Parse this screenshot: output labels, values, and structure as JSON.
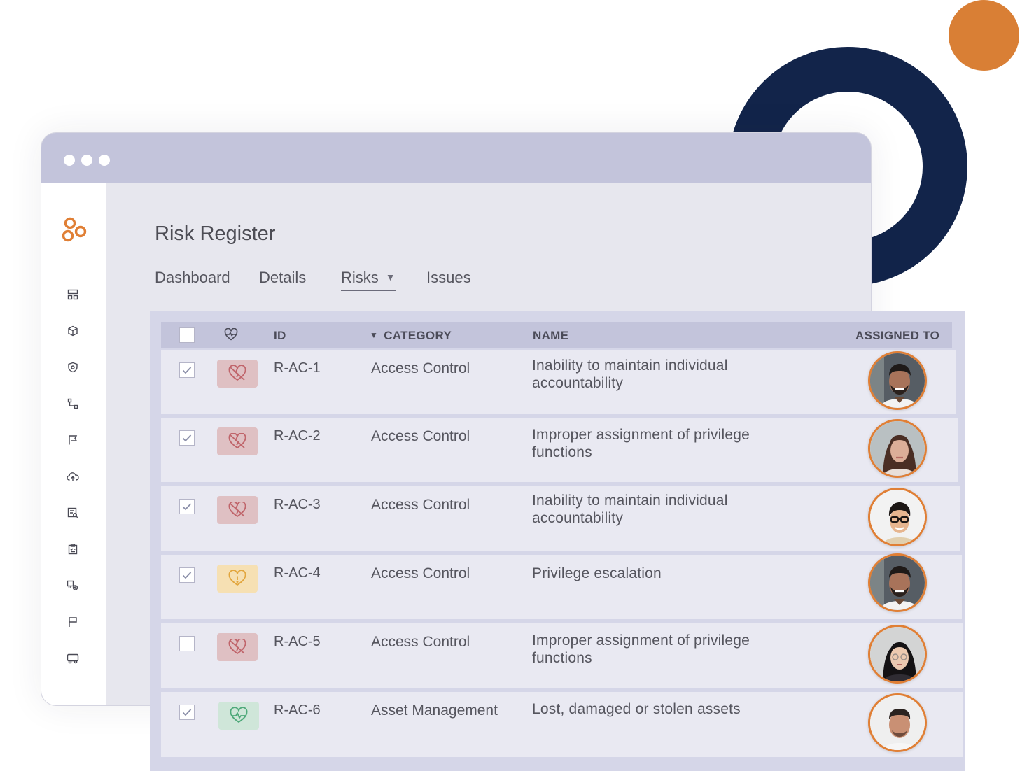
{
  "colors": {
    "accent_orange": "#d97f35",
    "ring_navy": "#12244a",
    "titlebar": "#c3c4db",
    "content_bg": "#e7e7ee",
    "table_panel": "#d5d6e8",
    "row_bg": "#e9e9f2",
    "risk_high": "#dfc0c3",
    "risk_medium": "#f6e0b3",
    "risk_low": "#cfe6d9"
  },
  "window": {
    "controls": [
      "dot",
      "dot",
      "dot"
    ]
  },
  "sidebar": {
    "logo": "app-logo-circles",
    "icons": [
      "dashboard-icon",
      "package-icon",
      "shield-icon",
      "workflow-icon",
      "bookmark-flag-icon",
      "cloud-upload-icon",
      "report-search-icon",
      "clipboard-checklist-icon",
      "vendor-settings-icon",
      "flag-icon",
      "truck-icon"
    ]
  },
  "page": {
    "title": "Risk Register"
  },
  "tabs": [
    {
      "label": "Dashboard",
      "active": false
    },
    {
      "label": "Details",
      "active": false
    },
    {
      "label": "Risks",
      "active": true,
      "caret": "▼"
    },
    {
      "label": "Issues",
      "active": false
    }
  ],
  "table": {
    "headers": {
      "health_icon": "heartbeat-icon",
      "id": "ID",
      "category": "CATEGORY",
      "category_sort": "▼",
      "name": "NAME",
      "assigned_to": "ASSIGNED TO"
    },
    "rows": [
      {
        "checked": true,
        "status": "high",
        "status_icon": "broken-heart-icon",
        "id": "R-AC-1",
        "category": "Access Control",
        "name": "Inability to maintain individual accountability",
        "avatar": "man-beard-avatar"
      },
      {
        "checked": true,
        "status": "high",
        "status_icon": "broken-heart-icon",
        "id": "R-AC-2",
        "category": "Access Control",
        "name": "Improper assignment of privilege functions",
        "avatar": "woman-dark-hair-avatar"
      },
      {
        "checked": true,
        "status": "high",
        "status_icon": "broken-heart-icon",
        "id": "R-AC-3",
        "category": "Access Control",
        "name": "Inability to maintain individual accountability",
        "avatar": "man-glasses-avatar"
      },
      {
        "checked": true,
        "status": "medium",
        "status_icon": "heart-warning-icon",
        "id": "R-AC-4",
        "category": "Access Control",
        "name": "Privilege escalation",
        "avatar": "man-beard-avatar"
      },
      {
        "checked": false,
        "status": "high",
        "status_icon": "broken-heart-icon",
        "id": "R-AC-5",
        "category": "Access Control",
        "name": "Improper assignment of privilege functions",
        "avatar": "woman-glasses-avatar"
      },
      {
        "checked": true,
        "status": "low",
        "status_icon": "heart-pulse-icon",
        "id": "R-AC-6",
        "category": "Asset Management",
        "name": "Lost, damaged or stolen assets",
        "avatar": "man-short-hair-avatar"
      }
    ]
  }
}
